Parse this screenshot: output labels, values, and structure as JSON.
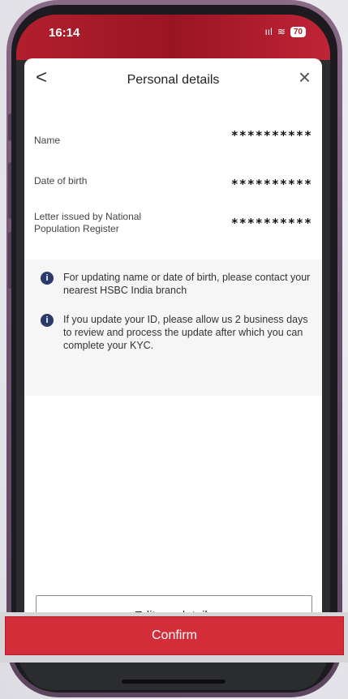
{
  "status_bar": {
    "time": "16:14",
    "signal": "ııl",
    "wifi": "≋",
    "battery": "70"
  },
  "header": {
    "back_glyph": "<",
    "title": "Personal details",
    "close_glyph": "×"
  },
  "details": [
    {
      "label": "Name",
      "value": "**********"
    },
    {
      "label": "Date of birth",
      "value": "**********"
    },
    {
      "label": "Letter issued by National\nPopulation Register",
      "value": "**********"
    }
  ],
  "info_notes": [
    {
      "icon": "info-icon",
      "text": "For updating name or date of birth, please contact your nearest HSBC India branch"
    },
    {
      "icon": "info-icon",
      "text": "If you update your ID, please allow us 2 business days to review and process the update after which you can complete your KYC."
    }
  ],
  "actions": {
    "edit_label": "Edit my details",
    "confirm_label": "Confirm"
  },
  "colors": {
    "brand_red": "#d42d3a",
    "info_icon": "#2b3a6b"
  }
}
